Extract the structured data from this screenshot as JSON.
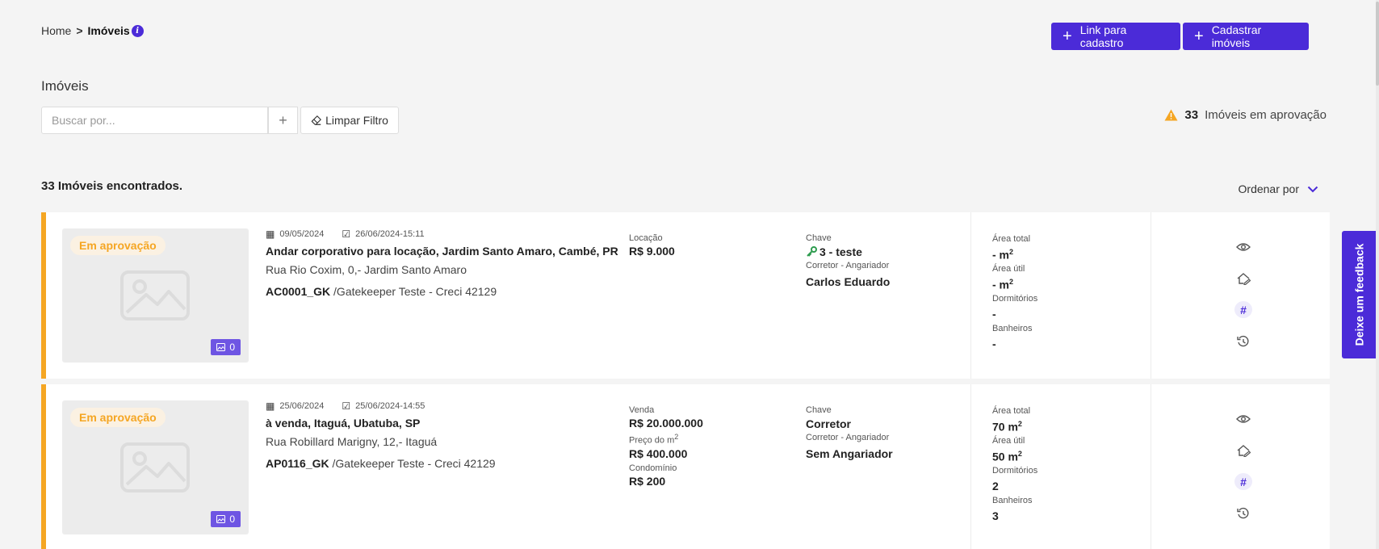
{
  "breadcrumb": {
    "home": "Home",
    "separator": ">",
    "current": "Imóveis",
    "info": "i"
  },
  "header": {
    "link_cadastro": "Link para cadastro",
    "cadastrar": "Cadastrar imóveis"
  },
  "page_title": "Imóveis",
  "search": {
    "placeholder": "Buscar por...",
    "add": "+",
    "clear": "Limpar Filtro"
  },
  "approval": {
    "count": "33",
    "label": "Imóveis em aprovação"
  },
  "results": {
    "found": "33 Imóveis encontrados.",
    "order_by": "Ordenar por"
  },
  "labels": {
    "chave": "Chave",
    "corretor_angariador": "Corretor - Angariador",
    "area_total": "Área total",
    "area_util": "Área útil",
    "dormitorios": "Dormitórios",
    "banheiros": "Banheiros",
    "status": "Em aprovação",
    "preco_m2": "Preço do m",
    "condominio": "Condomínio",
    "m2_unit": "m",
    "sup2": "2"
  },
  "properties": [
    {
      "photo_count": "0",
      "created": "09/05/2024",
      "updated": "26/06/2024-15:11",
      "title": "Andar corporativo para locação, Jardim Santo Amaro, Cambé, PR",
      "address": "Rua Rio Coxim, 0,- Jardim Santo Amaro",
      "code": "AC0001_GK",
      "agency": " /Gatekeeper Teste - Creci 42129",
      "deal_type": "Locação",
      "price": "R$ 9.000",
      "key": "3 - teste",
      "agent": "Carlos Eduardo",
      "area_total": "- m",
      "area_util": "- m",
      "dormitorios": "-",
      "banheiros": "-"
    },
    {
      "photo_count": "0",
      "created": "25/06/2024",
      "updated": "25/06/2024-14:55",
      "title": "à venda, Itaguá, Ubatuba, SP",
      "address": "Rua Robillard Marigny, 12,- Itaguá",
      "code": "AP0116_GK",
      "agency": " /Gatekeeper Teste - Creci 42129",
      "deal_type": "Venda",
      "price": "R$ 20.000.000",
      "price_m2": "R$ 400.000",
      "condominio": "R$ 200",
      "key": "Corretor",
      "agent": "Sem Angariador",
      "area_total": "70 m",
      "area_util": "50 m",
      "dormitorios": "2",
      "banheiros": "3"
    }
  ],
  "feedback": "Deixe um feedback",
  "colors": {
    "accent": "#4b2bd8",
    "pending": "#f5a623",
    "key_green": "#2e9c4f"
  },
  "icons": [
    "info-icon",
    "plus-icon",
    "eraser-icon",
    "warning-icon",
    "chevron-down-icon",
    "image-placeholder-icon",
    "photo-icon",
    "calendar-icon",
    "calendar-check-icon",
    "key-icon",
    "eye-icon",
    "house-edit-icon",
    "hash-icon",
    "history-icon"
  ]
}
